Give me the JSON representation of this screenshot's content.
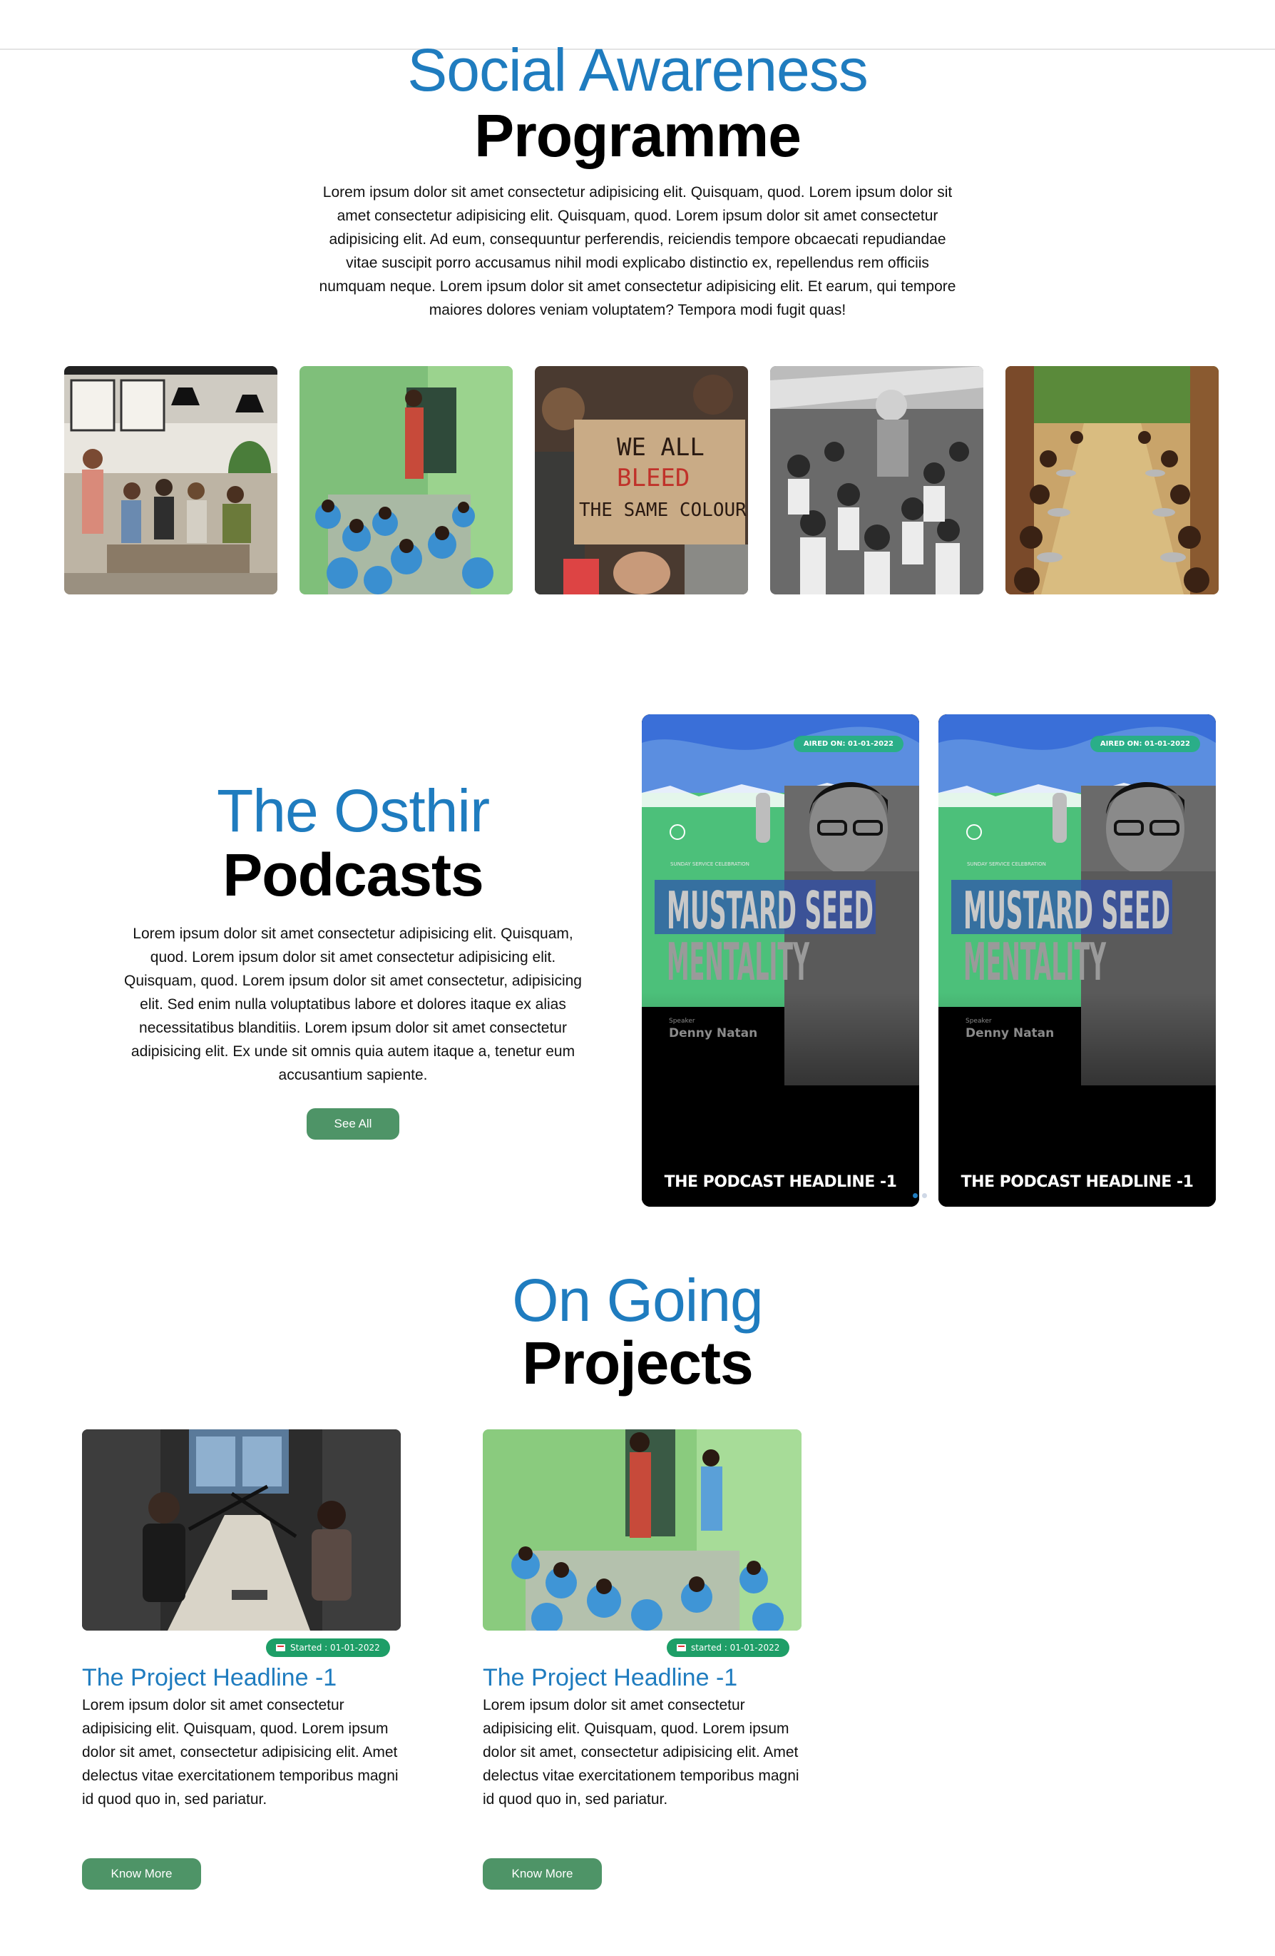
{
  "social": {
    "title_line1": "Social Awareness",
    "title_line2": "Programme",
    "description": "Lorem ipsum dolor sit amet consectetur adipisicing elit. Quisquam, quod. Lorem ipsum dolor sit amet consectetur adipisicing elit. Quisquam, quod. Lorem ipsum dolor sit amet consectetur adipisicing elit. Ad eum, consequuntur perferendis, reiciendis tempore obcaecati repudiandae vitae suscipit porro accusamus nihil modi explicabo distinctio ex, repellendus rem officiis numquam neque. Lorem ipsum dolor sit amet consectetur adipisicing elit. Et earum, qui tempore maiores dolores veniam voluptatem? Tempora modi fugit quas!",
    "gallery": [
      {
        "name": "workshop-photo"
      },
      {
        "name": "classroom-children-photo"
      },
      {
        "name": "protest-sign-photo",
        "sign_text": [
          "WE ALL",
          "BLEED",
          "THE SAME COLOUR"
        ]
      },
      {
        "name": "children-group-bw-photo"
      },
      {
        "name": "children-meal-photo"
      }
    ]
  },
  "podcasts": {
    "title_line1": "The Osthir",
    "title_line2": "Podcasts",
    "description": "Lorem ipsum dolor sit amet consectetur adipisicing elit. Quisquam, quod. Lorem ipsum dolor sit amet consectetur adipisicing elit. Quisquam, quod. Lorem ipsum dolor sit amet consectetur, adipisicing elit. Sed enim nulla voluptatibus labore et dolores itaque ex alias necessitatibus blanditiis. Lorem ipsum dolor sit amet consectetur adipisicing elit. Ex unde sit omnis quia autem itaque a, tenetur eum accusantium sapiente.",
    "see_all_label": "See All",
    "cards": [
      {
        "aired": "AIRED ON: 01-01-2022",
        "subtitle": "SUNDAY SERVICE CELEBRATION",
        "title1": "MUSTARD SEED",
        "title2": "MENTALITY",
        "speaker_label": "Speaker",
        "speaker": "Denny Natan",
        "headline": "THE PODCAST HEADLINE -1"
      },
      {
        "aired": "AIRED ON: 01-01-2022",
        "subtitle": "SUNDAY SERVICE CELEBRATION",
        "title1": "MUSTARD SEED",
        "title2": "MENTALITY",
        "speaker_label": "Speaker",
        "speaker": "Denny Natan",
        "headline": "THE PODCAST HEADLINE -1"
      }
    ],
    "colors": {
      "dot_active": "#1f7cbf",
      "dot_inactive": "#cfd8e6"
    }
  },
  "projects": {
    "title_line1": "On Going",
    "title_line2": "Projects",
    "items": [
      {
        "badge": "Started : 01-01-2022",
        "title": "The Project Headline -1",
        "description": "Lorem ipsum dolor sit amet consectetur adipisicing elit. Quisquam, quod. Lorem ipsum dolor sit amet, consectetur adipisicing elit. Amet delectus vitae exercitationem temporibus magni id quod quo in, sed pariatur.",
        "button": "Know More"
      },
      {
        "badge": "started : 01-01-2022",
        "title": "The Project Headline -1",
        "description": "Lorem ipsum dolor sit amet consectetur adipisicing elit. Quisquam, quod. Lorem ipsum dolor sit amet, consectetur adipisicing elit. Amet delectus vitae exercitationem temporibus magni id quod quo in, sed pariatur.",
        "button": "Know More"
      }
    ]
  },
  "colors": {
    "accent_blue": "#1f7cbf",
    "button_green": "#4e9467",
    "badge_green": "#1e9e67"
  }
}
